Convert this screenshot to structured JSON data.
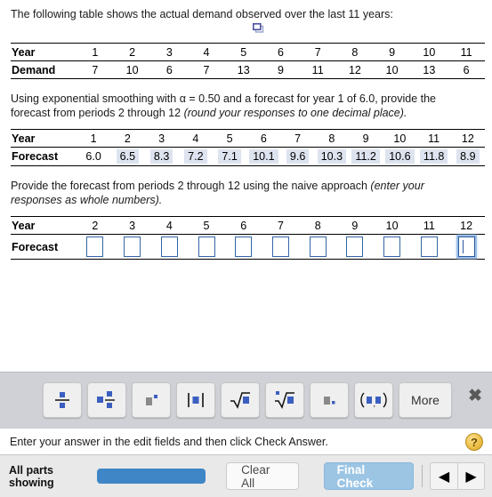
{
  "question": {
    "intro": "The following table shows the actual demand observed over the last 11 years:",
    "part_b_text_1": "Using exponential smoothing with α = 0.50 and a forecast for year 1 of 6.0, provide the",
    "part_b_text_2": "forecast from periods 2 through 12 ",
    "part_b_italic": "(round your responses to one decimal place).",
    "part_c_text_1": "Provide the forecast from periods 2 through 12 using the naive approach ",
    "part_c_italic_1": "(enter your",
    "part_c_italic_2": "responses as whole numbers)."
  },
  "demand_table": {
    "row_labels": [
      "Year",
      "Demand"
    ],
    "years": [
      "1",
      "2",
      "3",
      "4",
      "5",
      "6",
      "7",
      "8",
      "9",
      "10",
      "11"
    ],
    "demand": [
      "7",
      "10",
      "6",
      "7",
      "13",
      "9",
      "11",
      "12",
      "10",
      "13",
      "6"
    ],
    "popup_icon": "popup-window-icon"
  },
  "forecast_table": {
    "row_labels": [
      "Year",
      "Forecast"
    ],
    "years": [
      "1",
      "2",
      "3",
      "4",
      "5",
      "6",
      "7",
      "8",
      "9",
      "10",
      "11",
      "12"
    ],
    "forecast": [
      "6.0",
      "6.5",
      "8.3",
      "7.2",
      "7.1",
      "10.1",
      "9.6",
      "10.3",
      "11.2",
      "10.6",
      "11.8",
      "8.9"
    ],
    "highlighted": [
      false,
      true,
      true,
      true,
      true,
      true,
      true,
      true,
      true,
      true,
      true,
      true
    ],
    "highlight_color": "#dde3ef"
  },
  "naive_table": {
    "row_labels": [
      "Year",
      "Forecast"
    ],
    "years": [
      "2",
      "3",
      "4",
      "5",
      "6",
      "7",
      "8",
      "9",
      "10",
      "11",
      "12"
    ],
    "inputs": [
      "",
      "",
      "",
      "",
      "",
      "",
      "",
      "",
      "",
      "",
      ""
    ],
    "focused_index": 10,
    "input_border_color": "#3465a4"
  },
  "math_palette": {
    "buttons": [
      {
        "name": "fraction-button",
        "label": ""
      },
      {
        "name": "mixed-number-button",
        "label": ""
      },
      {
        "name": "exponent-button",
        "label": ""
      },
      {
        "name": "absolute-value-button",
        "label": ""
      },
      {
        "name": "square-root-button",
        "label": ""
      },
      {
        "name": "nth-root-button",
        "label": ""
      },
      {
        "name": "decimal-point-button",
        "label": ""
      },
      {
        "name": "interval-notation-button",
        "label": ""
      }
    ],
    "more_label": "More",
    "close_label": "✖",
    "accent_color": "#3b5fc0"
  },
  "instruction": {
    "text": "Enter your answer in the edit fields and then click Check Answer.",
    "help_label": "?"
  },
  "footer": {
    "all_parts_line1": "All parts",
    "all_parts_line2": "showing",
    "clear_all_label": "Clear All",
    "final_check_label": "Final Check",
    "prev_label": "◀",
    "next_label": "▶",
    "progress_color": "#3f86c6",
    "final_check_color": "#9cc5e4"
  }
}
